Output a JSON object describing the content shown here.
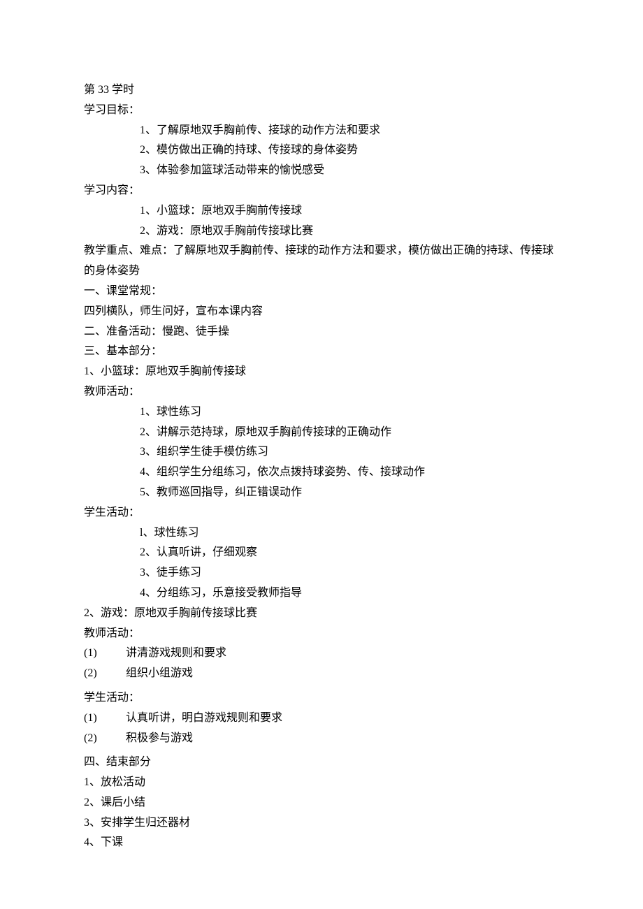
{
  "title": "第 33 学时",
  "section_goals_label": "学习目标：",
  "goals": [
    "1、了解原地双手胸前传、接球的动作方法和要求",
    "2、模仿做出正确的持球、传接球的身体姿势",
    "3、体验参加篮球活动带来的愉悦感受"
  ],
  "section_content_label": "学习内容：",
  "contents": [
    "1、小篮球：原地双手胸前传接球",
    "2、游戏：原地双手胸前传接球比赛"
  ],
  "keypoints": "教学重点、难点：了解原地双手胸前传、接球的动作方法和要求，模仿做出正确的持球、传接球的身体姿势",
  "part1_label": "一、课堂常规：",
  "part1_text": "四列横队，师生问好，宣布本课内容",
  "part2_label": "二、准备活动：慢跑、徒手操",
  "part3_label": "三、基本部分：",
  "basic1_label": "1、小篮球：原地双手胸前传接球",
  "teacher_label": "教师活动：",
  "teacher_items1": [
    "1、球性练习",
    "2、讲解示范持球，原地双手胸前传接球的正确动作",
    "3、组织学生徒手模仿练习",
    "4、组织学生分组练习，依次点拨持球姿势、传、接球动作",
    "5、教师巡回指导，纠正错误动作"
  ],
  "student_label": "学生活动：",
  "student_items1": [
    "l、球性练习",
    "2、认真听讲，仔细观察",
    "3、徒手练习",
    "4、分组练习，乐意接受教师指导"
  ],
  "basic2_label": "2、游戏：原地双手胸前传接球比赛",
  "teacher_label2": "教师活动：",
  "teacher_items2": [
    {
      "num": "(1)",
      "text": "讲清游戏规则和要求"
    },
    {
      "num": "(2)",
      "text": "组织小组游戏"
    }
  ],
  "student_label2": "学生活动：",
  "student_items2": [
    {
      "num": "(1)",
      "text": "认真听讲，明白游戏规则和要求"
    },
    {
      "num": "(2)",
      "text": "积极参与游戏"
    }
  ],
  "part4_label": "四、结束部分",
  "end_items": [
    "1、放松活动",
    "2、课后小结",
    "3、安排学生归还器材",
    "4、下课"
  ]
}
